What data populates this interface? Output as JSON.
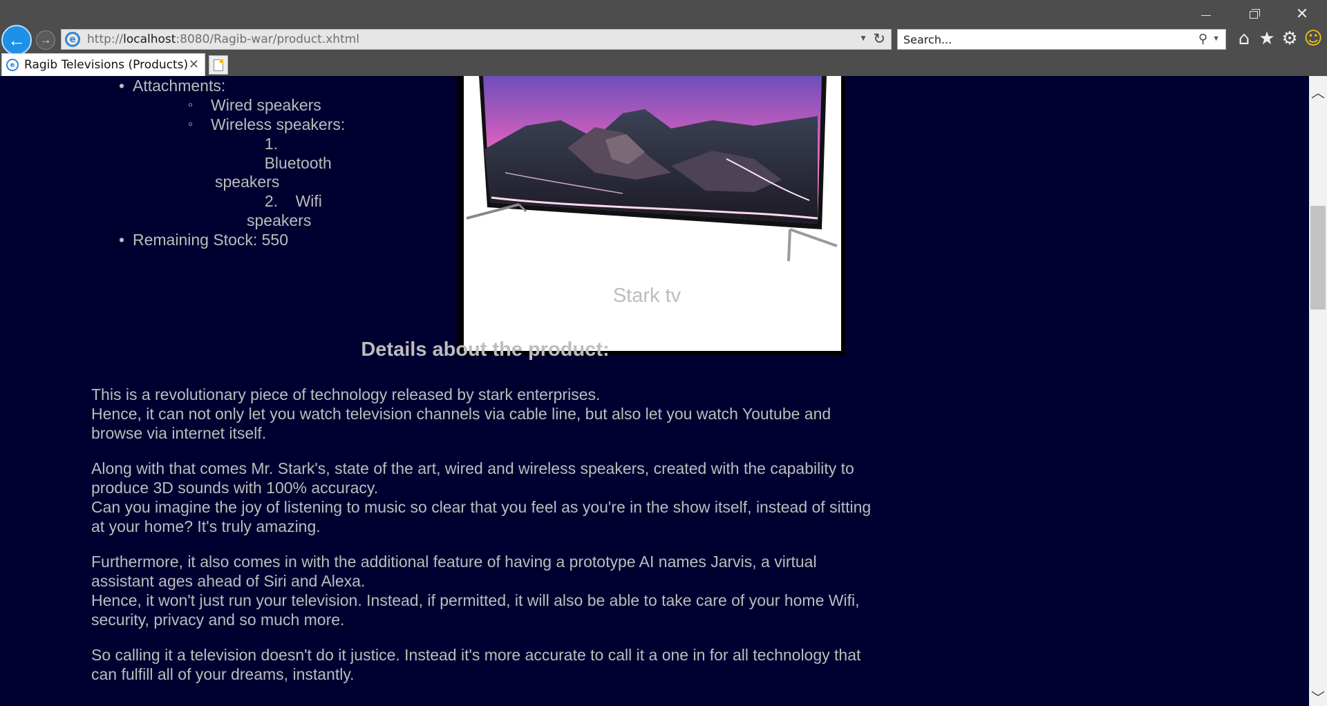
{
  "browser": {
    "url_prefix": "http://",
    "url_host": "localhost",
    "url_rest": ":8080/Ragib-war/product.xhtml",
    "search_placeholder": "Search...",
    "tab_title": "Ragib Televisions (Products)",
    "icons": [
      "back-arrow-icon",
      "forward-arrow-icon",
      "ie-icon",
      "refresh-icon",
      "search-icon",
      "home-icon",
      "star-icon",
      "gear-icon",
      "smiley-icon",
      "new-tab-icon"
    ]
  },
  "specs": {
    "attachments_label": "Attachments:",
    "wired": "Wired speakers",
    "wireless": "Wireless speakers:",
    "wireless_items": [
      {
        "num": "1.",
        "text_a": "Bluetooth",
        "text_b": "speakers"
      },
      {
        "num": "2.",
        "text_a": "Wifi speakers"
      }
    ],
    "remaining_stock": "Remaining Stock: 550"
  },
  "product": {
    "caption": "Stark tv"
  },
  "details": {
    "heading": "Details about the product:",
    "p1_line1": "This is a revolutionary piece of technology released by stark enterprises.",
    "p1_line2": "Hence, it can not only let you watch television channels via cable line, but also let you watch Youtube and browse via internet itself.",
    "p2_line1": "Along with that comes Mr. Stark's, state of the art, wired and wireless speakers, created with the capability to produce 3D sounds with 100% accuracy.",
    "p2_line2": "Can you imagine the joy of listening to music so clear that you feel as you're in the show itself, instead of sitting at your home? It's truly amazing.",
    "p3_line1": "Furthermore, it also comes in with the additional feature of having a prototype AI names Jarvis, a virtual assistant ages ahead of Siri and Alexa.",
    "p3_line2": "Hence, it won't just run your television. Instead, if permitted, it will also be able to take care of your home Wifi, security, privacy and so much more.",
    "p4_line1": "So calling it a television doesn't do it justice. Instead it's more accurate to call it a one in for all technology that can fulfill all of your dreams, instantly."
  },
  "colors": {
    "page_bg": "#000030",
    "text": "#bdbdbd",
    "chrome": "#4d4d4d",
    "accent": "#1e90e8"
  }
}
